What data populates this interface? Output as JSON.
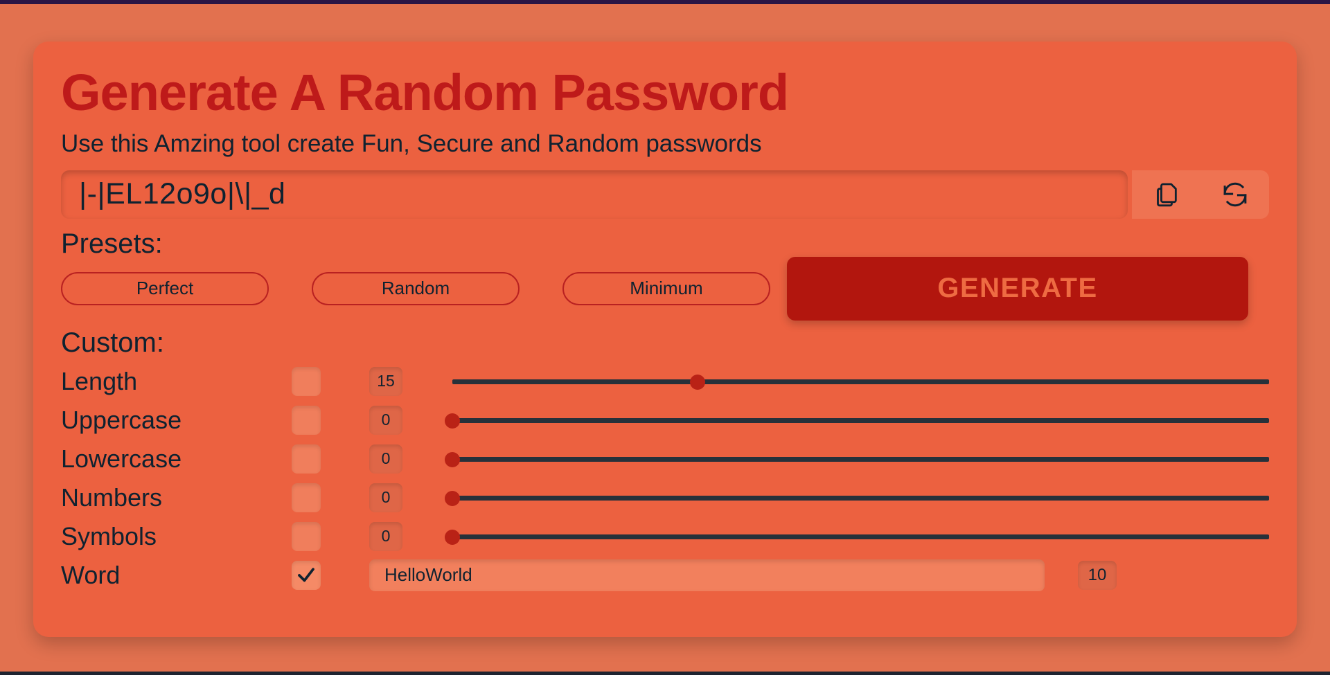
{
  "app": {
    "title": "Generate A Random Password",
    "subtitle": "Use this Amzing tool create Fun, Secure and Random passwords",
    "accent_red": "#B92121",
    "accent_dark_red": "#B2160E",
    "background": "#E2714F",
    "card_background": "#EC6140",
    "text_color": "#0F2230"
  },
  "password": {
    "value": "|-|EL12o9o|\\|_d",
    "copy_icon": "copy-icon",
    "refresh_icon": "refresh-icon"
  },
  "presets": {
    "label": "Presets:",
    "buttons": [
      {
        "label": "Perfect"
      },
      {
        "label": "Random"
      },
      {
        "label": "Minimum"
      }
    ],
    "generate_label": "GENERATE"
  },
  "custom": {
    "label": "Custom:",
    "rows": [
      {
        "name": "Length",
        "checked": false,
        "value": "15",
        "slider": 30
      },
      {
        "name": "Uppercase",
        "checked": false,
        "value": "0",
        "slider": 0
      },
      {
        "name": "Lowercase",
        "checked": false,
        "value": "0",
        "slider": 0
      },
      {
        "name": "Numbers",
        "checked": false,
        "value": "0",
        "slider": 0
      },
      {
        "name": "Symbols",
        "checked": false,
        "value": "0",
        "slider": 0
      }
    ],
    "word_row": {
      "name": "Word",
      "checked": true,
      "word_value": "HelloWorld",
      "count_value": "10"
    }
  }
}
